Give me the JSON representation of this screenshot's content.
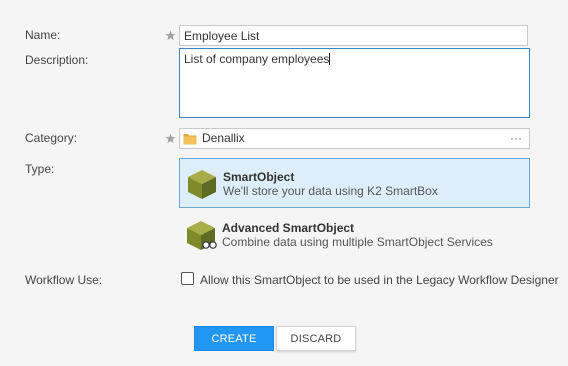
{
  "form": {
    "name_label": "Name:",
    "name_value": "Employee List",
    "description_label": "Description:",
    "description_value": "List of company employees",
    "category_label": "Category:",
    "category_value": "Denallix",
    "category_browse": "···",
    "type_label": "Type:",
    "workflow_label": "Workflow Use:"
  },
  "types": [
    {
      "title": "SmartObject",
      "description": "We'll store your data using K2 SmartBox",
      "selected": true
    },
    {
      "title": "Advanced SmartObject",
      "description": "Combine data using multiple SmartObject Services",
      "selected": false
    }
  ],
  "workflow": {
    "checkbox_label": "Allow this SmartObject to be used in the Legacy Workflow Designer",
    "checked": false
  },
  "buttons": {
    "create": "CREATE",
    "discard": "DISCARD"
  },
  "colors": {
    "accent": "#2196f3",
    "selected_bg": "#ddeefa",
    "selected_border": "#6aa6d6",
    "cube_top": "#a9ad49",
    "cube_left": "#7f8a2b",
    "cube_right": "#5e6b23"
  }
}
